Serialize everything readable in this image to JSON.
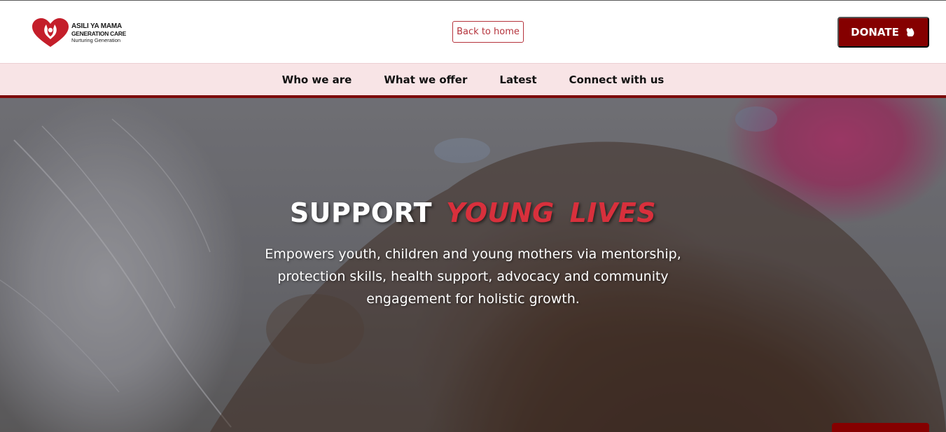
{
  "header": {
    "logo": {
      "line1": "ASILI YA MAMA",
      "line2": "GENERATION CARE",
      "line3": "Nurturing Generation",
      "icon": "heart-hands-icon"
    },
    "back_home_label": "Back to home",
    "donate_label": "DONATE",
    "donate_icon": "hand-heart-icon"
  },
  "nav": {
    "items": [
      {
        "label": "Who we are"
      },
      {
        "label": "What we offer"
      },
      {
        "label": "Latest"
      },
      {
        "label": "Connect with us"
      }
    ]
  },
  "hero": {
    "title_part1": "SUPPORT",
    "title_part2": "YOUNG LIVES",
    "subtitle": "Empowers youth, children and young mothers via mentorship, protection skills, health support, advocacy and community engagement for holistic growth."
  },
  "colors": {
    "brand_red": "#850000",
    "accent_red": "#d8303c",
    "nav_bg": "#f8e4e6",
    "outline_red": "#b5333c"
  }
}
